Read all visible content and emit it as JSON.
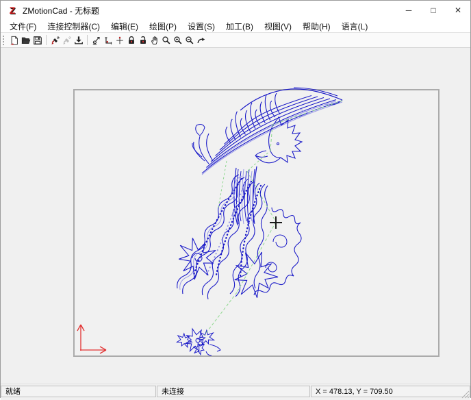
{
  "window": {
    "logo": "Z",
    "title": "ZMotionCad - 无标题",
    "controls": {
      "minimize": "─",
      "maximize": "□",
      "close": "✕"
    }
  },
  "menus": [
    "文件(F)",
    "连接控制器(C)",
    "编辑(E)",
    "绘图(P)",
    "设置(S)",
    "加工(B)",
    "视图(V)",
    "帮助(H)",
    "语言(L)"
  ],
  "toolbar": {
    "icons": [
      "new-file",
      "open-file",
      "save-file",
      "connect-controller",
      "disconnect-controller",
      "download-to-controller",
      "machining-tool",
      "origin-corner",
      "center-point",
      "lock",
      "unlock",
      "pan-hand",
      "zoom",
      "zoom-in",
      "zoom-out",
      "redo"
    ]
  },
  "statusbar": {
    "ready": "就绪",
    "connection": "未连接",
    "coords": "X = 478.13, Y = 709.50"
  },
  "colors": {
    "draw_blue": "#1b1bc8",
    "accent_lavender": "#9a9ae8",
    "path_green": "#8fd88f",
    "axis_red": "#e23232"
  }
}
